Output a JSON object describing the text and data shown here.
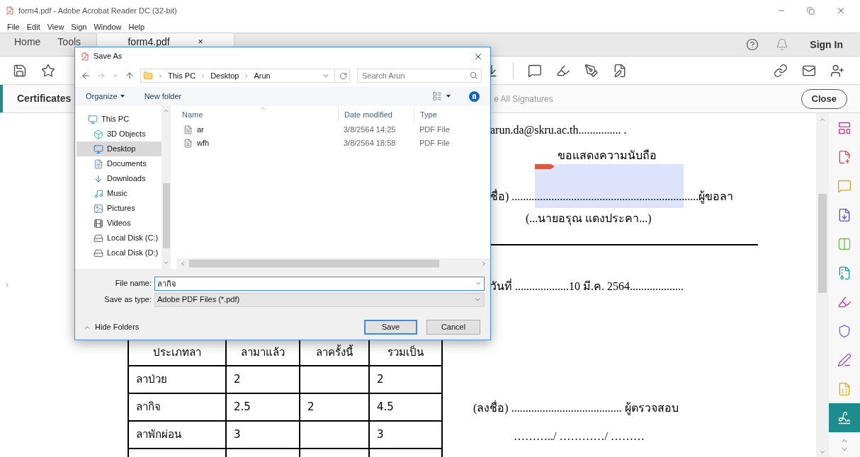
{
  "window": {
    "title": "form4.pdf - Adobe Acrobat Reader DC (32-bit)"
  },
  "menu": [
    "File",
    "Edit",
    "View",
    "Sign",
    "Window",
    "Help"
  ],
  "tabs": [
    {
      "label": "Home",
      "selected": false
    },
    {
      "label": "Tools",
      "selected": false
    },
    {
      "label": "form4.pdf",
      "selected": true,
      "close": "×"
    }
  ],
  "sign_in": "Sign In",
  "panel": {
    "title": "Certificates",
    "action": "e All Signatures",
    "close": "Close"
  },
  "document": {
    "email": "arun.da@skru.ac.th............... .",
    "closing": "ขอแสดงความนับถือ",
    "signature_line": "ชื่อ)  ..................................................................ผู้ขอลา",
    "signer": "(...นายอรุณ แดงประคา...)",
    "date_line": "วันที่ ...................10 มี.ค. 2564...................",
    "table": {
      "columns": [
        "ประเภทลา",
        "ลามาแล้ว",
        "ลาครั้งนี้",
        "รวมเป็น"
      ],
      "rows": [
        [
          "ลาป่วย",
          "2",
          "",
          "2"
        ],
        [
          "ลากิจ",
          "2.5",
          "2",
          "4.5"
        ],
        [
          "ลาพักผ่อน",
          "3",
          "",
          "3"
        ]
      ]
    },
    "checker_line": "(ลงชื่อ) ....................................... ผู้ตรวจสอบ",
    "checker_date": "………../ …………/ ………"
  },
  "tools": [
    {
      "kind": "layout",
      "selected": false
    },
    {
      "kind": "create",
      "selected": false
    },
    {
      "kind": "comment",
      "selected": false
    },
    {
      "kind": "combine",
      "selected": false
    },
    {
      "kind": "organize",
      "selected": false
    },
    {
      "kind": "compress",
      "selected": false
    },
    {
      "kind": "highlight",
      "selected": false
    },
    {
      "kind": "protect",
      "selected": false
    },
    {
      "kind": "sign",
      "selected": false
    },
    {
      "kind": "form",
      "selected": false
    },
    {
      "kind": "certificate",
      "selected": true
    }
  ],
  "dialog": {
    "title": "Save As",
    "path": [
      "This PC",
      "Desktop",
      "Arun"
    ],
    "search": {
      "placeholder": "Search Arun"
    },
    "organize": "Organize",
    "new_folder": "New folder",
    "nav": [
      {
        "label": "This PC",
        "kind": "pc",
        "selected": false
      },
      {
        "label": "3D Objects",
        "kind": "objects",
        "selected": false
      },
      {
        "label": "Desktop",
        "kind": "desktop",
        "selected": true
      },
      {
        "label": "Documents",
        "kind": "documents",
        "selected": false
      },
      {
        "label": "Downloads",
        "kind": "downloads",
        "selected": false
      },
      {
        "label": "Music",
        "kind": "music",
        "selected": false
      },
      {
        "label": "Pictures",
        "kind": "pictures",
        "selected": false
      },
      {
        "label": "Videos",
        "kind": "videos",
        "selected": false
      },
      {
        "label": "Local Disk (C:)",
        "kind": "disk",
        "selected": false
      },
      {
        "label": "Local Disk (D:)",
        "kind": "disk",
        "selected": false
      }
    ],
    "columns": [
      "Name",
      "Date modified",
      "Type"
    ],
    "files": [
      {
        "name": "ar",
        "date": "3/8/2564 14:25",
        "type": "PDF File"
      },
      {
        "name": "wfh",
        "date": "3/8/2564 18:58",
        "type": "PDF File"
      }
    ],
    "file_name_label": "File name:",
    "file_name": "ลากิจ",
    "type_label": "Save as type:",
    "type": "Adobe PDF Files (*.pdf)",
    "hide_folders": "Hide Folders",
    "save": "Save",
    "cancel": "Cancel"
  }
}
